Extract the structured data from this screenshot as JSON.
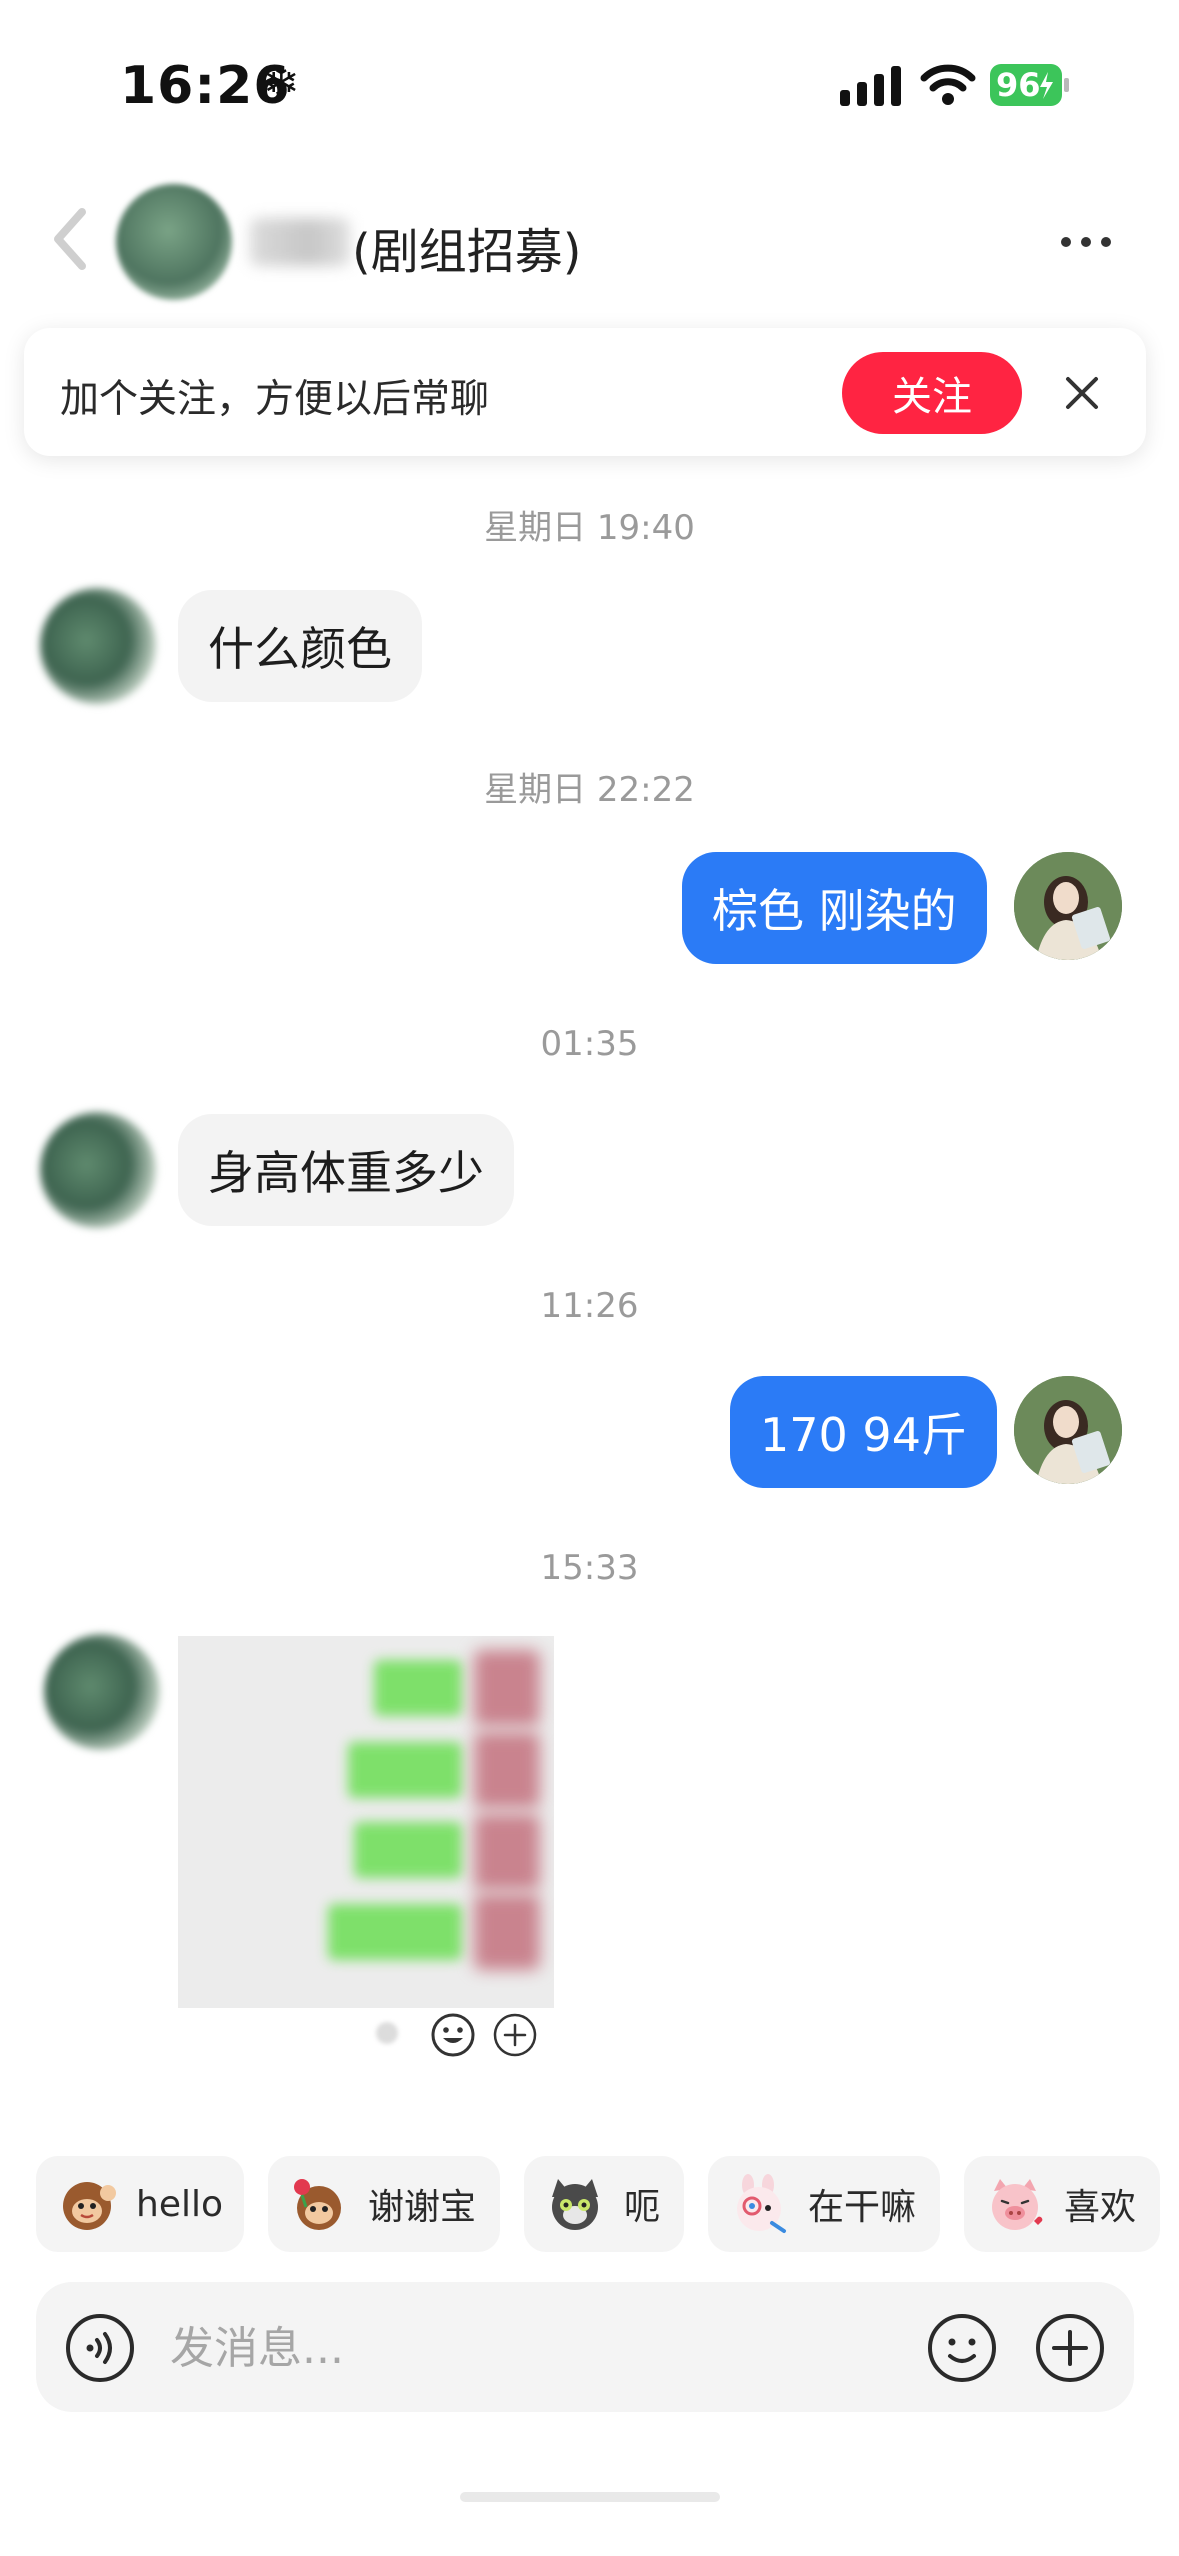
{
  "status_bar": {
    "time": "16:26",
    "extra_icon": "❄",
    "battery": "96"
  },
  "header": {
    "name": "(剧组招募)"
  },
  "follow_banner": {
    "text": "加个关注，方便以后常聊",
    "button": "关注"
  },
  "messages": [
    {
      "type": "timestamp",
      "text": "星期日 19:40"
    },
    {
      "type": "incoming",
      "text": "什么颜色"
    },
    {
      "type": "timestamp",
      "text": "星期日 22:22"
    },
    {
      "type": "outgoing",
      "text": "棕色 刚染的"
    },
    {
      "type": "timestamp",
      "text": "01:35"
    },
    {
      "type": "incoming",
      "text": "身高体重多少"
    },
    {
      "type": "timestamp",
      "text": "11:26"
    },
    {
      "type": "outgoing",
      "text": "170 94斤"
    },
    {
      "type": "timestamp",
      "text": "15:33"
    },
    {
      "type": "incoming-image"
    }
  ],
  "quick_replies": [
    {
      "label": "hello",
      "icon": "monkey-wave-sticker-icon"
    },
    {
      "label": "谢谢宝",
      "icon": "monkey-flower-sticker-icon"
    },
    {
      "label": "呃",
      "icon": "cat-awkward-sticker-icon"
    },
    {
      "label": "在干嘛",
      "icon": "rabbit-peek-sticker-icon"
    },
    {
      "label": "喜欢",
      "icon": "pig-love-sticker-icon"
    }
  ],
  "composer": {
    "placeholder": "发消息..."
  },
  "colors": {
    "accent_red": "#ff2442",
    "outgoing_bubble": "#2b7bf6",
    "incoming_bubble": "#f3f3f3",
    "battery_green": "#3cc55a"
  }
}
